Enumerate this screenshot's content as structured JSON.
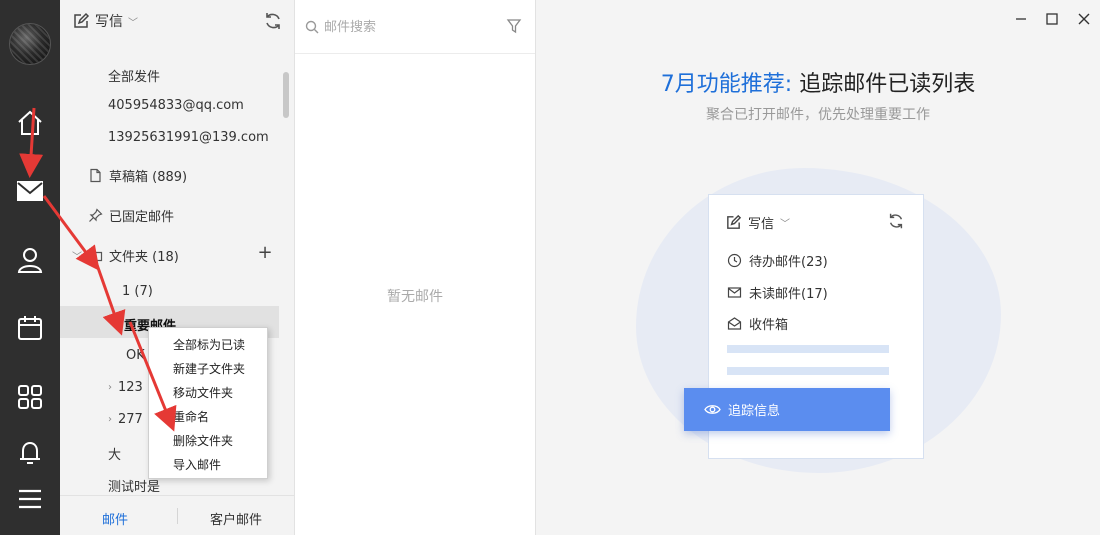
{
  "rail": {
    "icons": [
      "avatar",
      "home-icon",
      "mail-icon",
      "contacts-icon",
      "calendar-icon",
      "apps-icon",
      "bell-icon",
      "menu-icon"
    ]
  },
  "folder_panel": {
    "compose_label": "写信",
    "items": [
      {
        "label": "全部发件"
      },
      {
        "label": "405954833@qq.com"
      },
      {
        "label": "13925631991@139.com"
      },
      {
        "label": "草稿箱 (889)"
      },
      {
        "label": "已固定邮件"
      },
      {
        "label": "文件夹 (18)"
      },
      {
        "label": "1   (7)"
      },
      {
        "label": "重要邮件"
      },
      {
        "label": "OK"
      },
      {
        "label": "123"
      },
      {
        "label": "277"
      },
      {
        "label": "大"
      },
      {
        "label": "测试时是"
      }
    ],
    "footer": {
      "mail_tab": "邮件",
      "customer_tab": "客户邮件"
    }
  },
  "context_menu": {
    "items": [
      "全部标为已读",
      "新建子文件夹",
      "移动文件夹",
      "重命名",
      "删除文件夹",
      "导入邮件"
    ]
  },
  "message_list": {
    "search_placeholder": "邮件搜索",
    "empty_text": "暂无邮件"
  },
  "promo": {
    "title_accent": "7月功能推荐:",
    "title_rest": " 追踪邮件已读列表",
    "subtitle": "聚合已打开邮件，优先处理重要工作",
    "card": {
      "compose_label": "写信",
      "rows": [
        "待办邮件(23)",
        "未读邮件(17)",
        "收件箱"
      ],
      "track_button": "追踪信息"
    }
  },
  "colors": {
    "accent": "#1e6fd9",
    "rail": "#2f2f2f",
    "annotation_arrow": "#e53935",
    "track_button": "#5b8def"
  }
}
